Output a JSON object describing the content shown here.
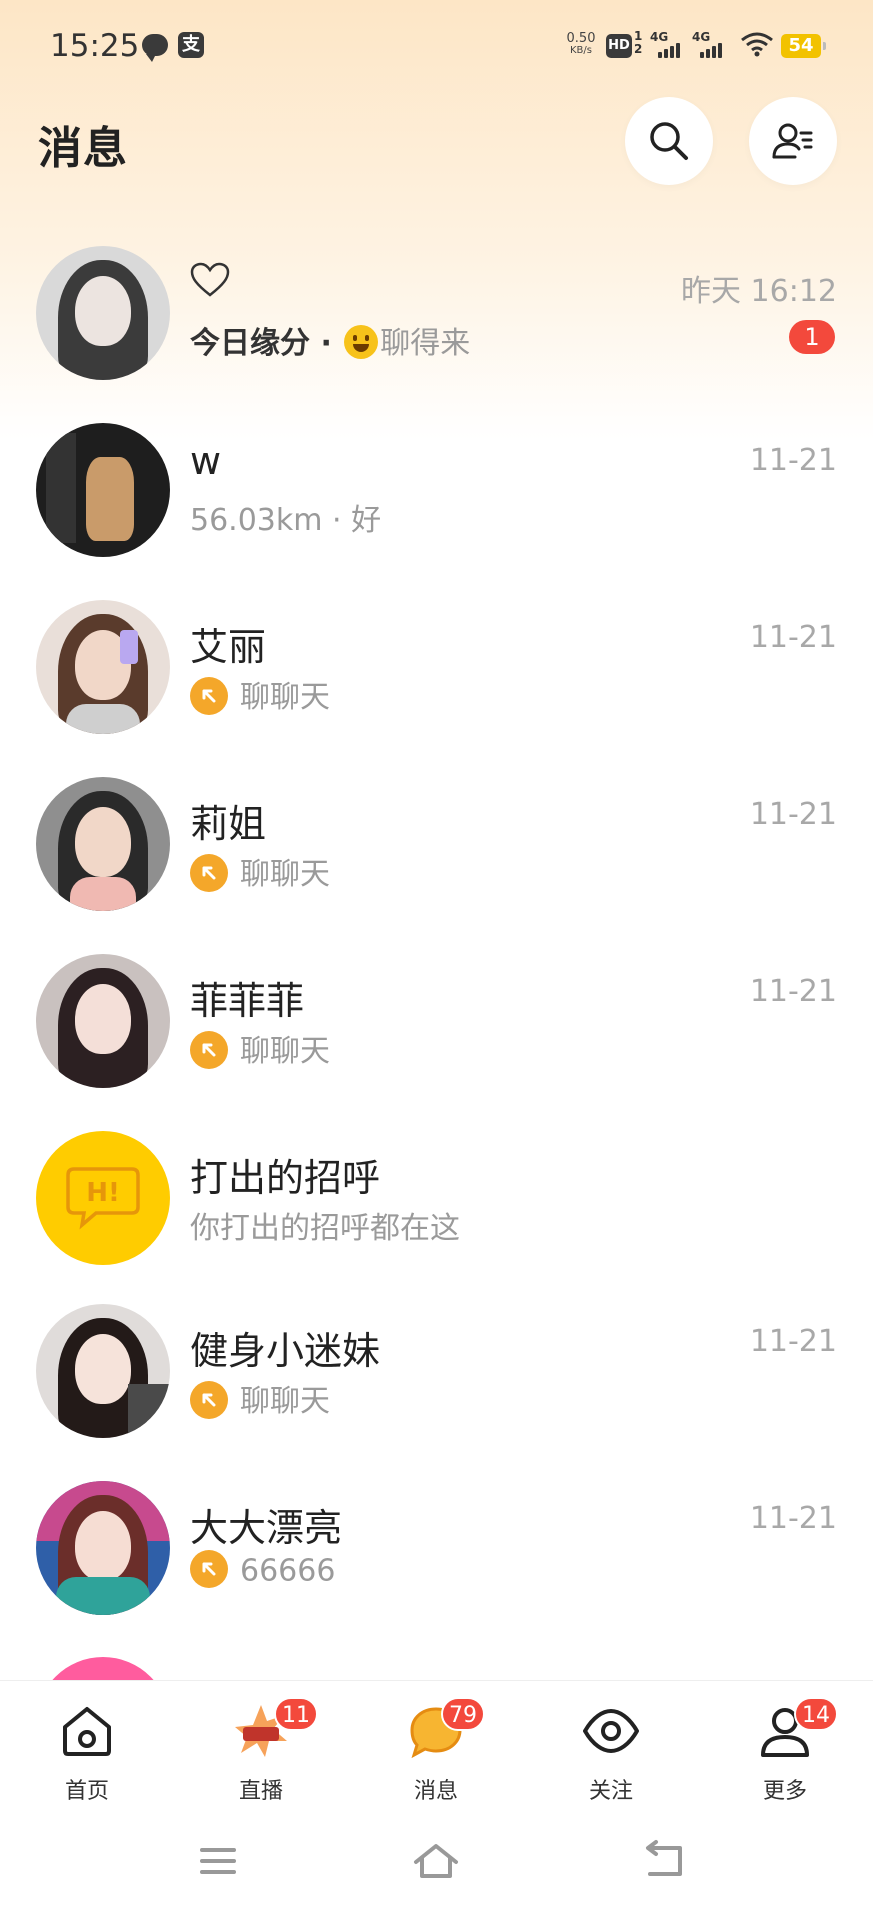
{
  "status_bar": {
    "time": "15:25",
    "app_icon_glyph": "支",
    "net_speed_value": "0.50",
    "net_speed_unit": "KB/s",
    "hd_label": "HD",
    "hd_sub_top": "1",
    "hd_sub_bottom": "2",
    "sig1_label": "4G",
    "sig2_label": "4G",
    "battery": "54"
  },
  "header": {
    "title": "消息",
    "search_icon": "search-icon",
    "contacts_icon": "contacts-settings-icon"
  },
  "messages": [
    {
      "name": "",
      "prefix": "今日缘分 · ",
      "preview": "聊得来",
      "time": "昨天 16:12",
      "unread": "1",
      "icon": "heart-outline-icon"
    },
    {
      "name": "w",
      "preview": "56.03km · 好",
      "time": "11-21"
    },
    {
      "name": "艾丽",
      "preview": "聊聊天",
      "time": "11-21",
      "icon": "wave-arrow-icon"
    },
    {
      "name": "莉姐",
      "preview": "聊聊天",
      "time": "11-21",
      "icon": "wave-arrow-icon"
    },
    {
      "name": "菲菲菲",
      "preview": "聊聊天",
      "time": "11-21",
      "icon": "wave-arrow-icon"
    },
    {
      "name": "打出的招呼",
      "preview": "你打出的招呼都在这",
      "badge_text": "H!",
      "icon": "greeting-bubble-icon"
    },
    {
      "name": "健身小迷妹",
      "preview": "聊聊天",
      "time": "11-21",
      "icon": "wave-arrow-icon"
    },
    {
      "name": "大大漂亮",
      "preview": "66666",
      "time": "11-21",
      "icon": "wave-arrow-icon"
    }
  ],
  "bottom_nav": [
    {
      "label": "首页",
      "icon": "home-icon"
    },
    {
      "label": "直播",
      "icon": "live-icon",
      "badge": "11"
    },
    {
      "label": "消息",
      "icon": "message-bubble-icon",
      "badge": "79",
      "active": true
    },
    {
      "label": "关注",
      "icon": "eye-icon"
    },
    {
      "label": "更多",
      "icon": "person-icon",
      "badge": "14"
    }
  ],
  "system_nav": {
    "menu_icon": "menu-icon",
    "home_icon": "home-outline-icon",
    "back_icon": "back-icon"
  },
  "colors": {
    "accent_orange": "#f4a72a",
    "badge_red": "#f3493c",
    "greeting_yellow": "#ffcc00"
  }
}
